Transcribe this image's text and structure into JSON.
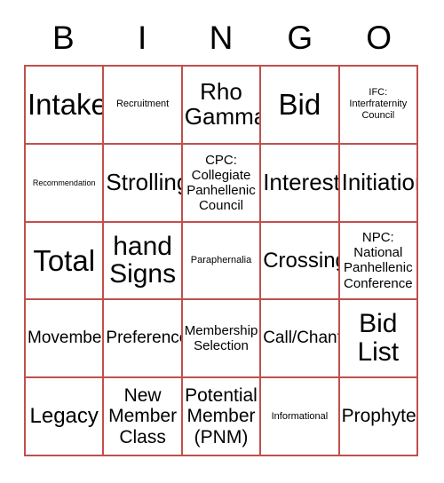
{
  "card": {
    "title": "BINGO Card",
    "border_color": "#c0504d",
    "background_color": "#ffffff",
    "text_color": "#000000",
    "columns": 5,
    "rows": 5,
    "header": [
      "B",
      "I",
      "N",
      "G",
      "O"
    ],
    "cells": [
      {
        "text": "Intake",
        "size": "fs-5xl"
      },
      {
        "text": "Recruitment",
        "size": "fs-s"
      },
      {
        "text": "Rho\nGamma",
        "size": "fs-3xl"
      },
      {
        "text": "Bid",
        "size": "fs-5xl"
      },
      {
        "text": "IFC:\nInterfraternity\nCouncil",
        "size": "fs-s"
      },
      {
        "text": "Recommendation",
        "size": "fs-xs"
      },
      {
        "text": "Strolling",
        "size": "fs-3xl"
      },
      {
        "text": "CPC:\nCollegiate\nPanhellenic\nCouncil",
        "size": "fs-m"
      },
      {
        "text": "Interest",
        "size": "fs-3xl"
      },
      {
        "text": "Initiation",
        "size": "fs-3xl"
      },
      {
        "text": "Total",
        "size": "fs-5xl"
      },
      {
        "text": "hand\nSigns",
        "size": "fs-4xl"
      },
      {
        "text": "Paraphernalia",
        "size": "fs-s"
      },
      {
        "text": "Crossing",
        "size": "fs-2xl"
      },
      {
        "text": "NPC:\nNational\nPanhellenic\nConference",
        "size": "fs-m"
      },
      {
        "text": "Movember",
        "size": "fs-l"
      },
      {
        "text": "Preference",
        "size": "fs-l"
      },
      {
        "text": "Membership\nSelection",
        "size": "fs-m"
      },
      {
        "text": "Call/Chant",
        "size": "fs-l"
      },
      {
        "text": "Bid\nList",
        "size": "fs-4xl"
      },
      {
        "text": "Legacy",
        "size": "fs-2xl"
      },
      {
        "text": "New\nMember\nClass",
        "size": "fs-xl"
      },
      {
        "text": "Potential\nMember\n(PNM)",
        "size": "fs-xl"
      },
      {
        "text": "Informational",
        "size": "fs-s"
      },
      {
        "text": "Prophyte",
        "size": "fs-xl"
      }
    ]
  }
}
